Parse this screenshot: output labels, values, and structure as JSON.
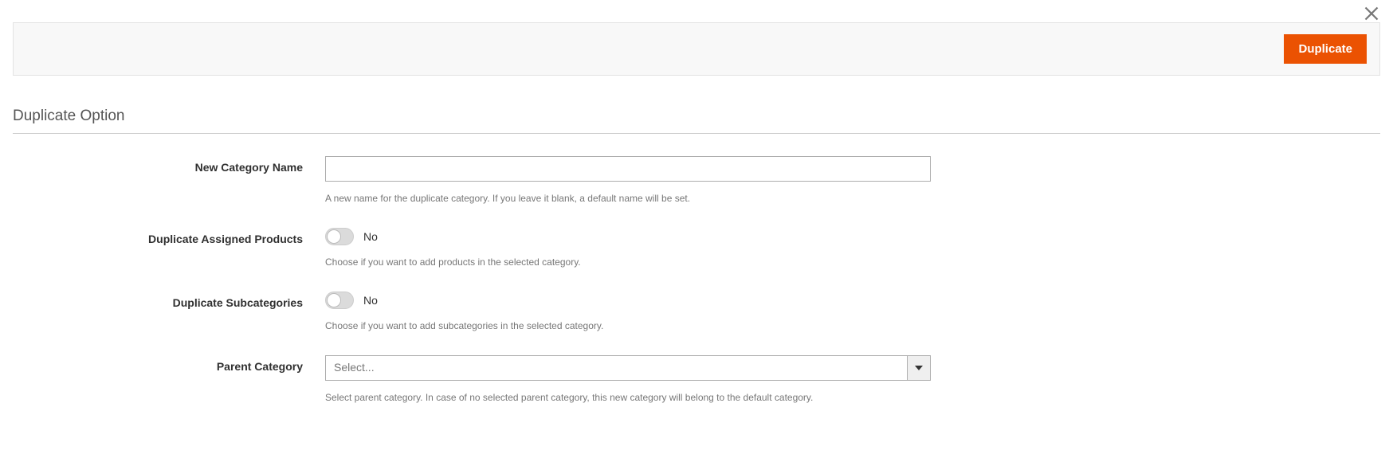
{
  "header": {
    "duplicate_button": "Duplicate"
  },
  "section_title": "Duplicate Option",
  "fields": {
    "new_category_name": {
      "label": "New Category Name",
      "value": "",
      "hint": "A new name for the duplicate category. If you leave it blank, a default name will be set."
    },
    "duplicate_assigned_products": {
      "label": "Duplicate Assigned Products",
      "value": "No",
      "hint": "Choose if you want to add products in the selected category."
    },
    "duplicate_subcategories": {
      "label": "Duplicate Subcategories",
      "value": "No",
      "hint": "Choose if you want to add subcategories in the selected category."
    },
    "parent_category": {
      "label": "Parent Category",
      "selected": "Select...",
      "hint": "Select parent category. In case of no selected parent category, this new category will belong to the default category."
    }
  }
}
